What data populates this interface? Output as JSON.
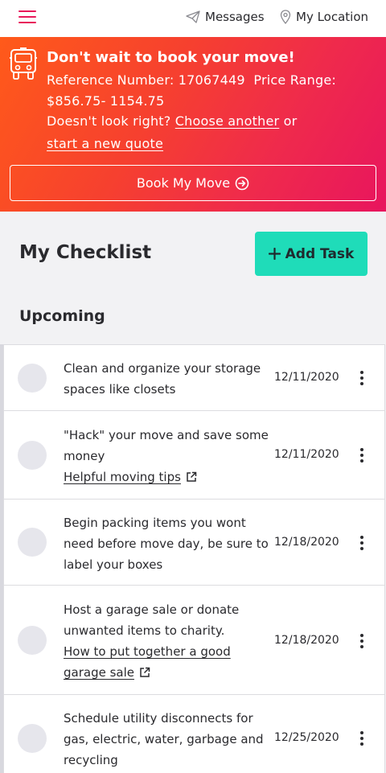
{
  "header": {
    "menu_icon": "hamburger-icon",
    "messages_label": "Messages",
    "location_label": "My Location"
  },
  "banner": {
    "title": "Don't wait to book your move!",
    "reference_label": "Reference Number:",
    "reference_number": "17067449",
    "price_label": "Price Range:",
    "price_range": "$856.75- 1154.75",
    "prompt": "Doesn't look right?",
    "choose_link": "Choose another",
    "or_text": "or",
    "new_quote_link": "start a new quote",
    "book_button": "Book My Move"
  },
  "checklist": {
    "title": "My Checklist",
    "add_task_label": "Add Task",
    "section_title": "Upcoming",
    "tasks": [
      {
        "text": "Clean and organize your storage spaces like closets",
        "link": "",
        "date": "12/11/2020"
      },
      {
        "text": "\"Hack\" your move and save some money",
        "link": "Helpful moving tips",
        "date": "12/11/2020"
      },
      {
        "text": "Begin packing items you wont need before move day, be sure to label your boxes",
        "link": "",
        "date": "12/18/2020"
      },
      {
        "text": "Host a garage sale or donate unwanted items to charity.",
        "link": "How to put together a good garage sale",
        "date": "12/18/2020"
      },
      {
        "text": "Schedule utility disconnects for gas, electric, water, garbage and recycling",
        "link": "",
        "date": "12/25/2020"
      }
    ]
  },
  "colors": {
    "accent": "#e8195a",
    "banner_start": "#ff5a1a",
    "banner_end": "#e8155e",
    "add_task_bg": "#1fdcb9"
  }
}
